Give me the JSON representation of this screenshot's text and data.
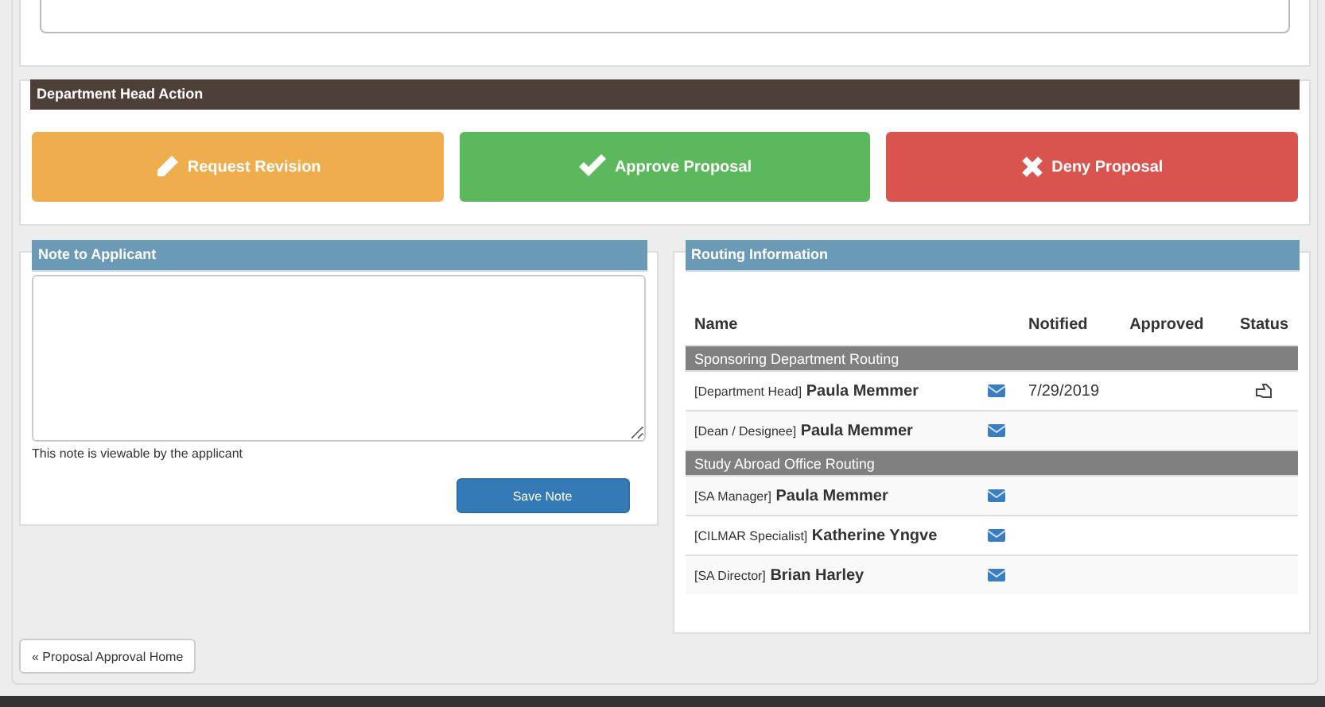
{
  "action_panel": {
    "title": "Department Head Action",
    "buttons": [
      {
        "kind": "revise",
        "label": "Request Revision"
      },
      {
        "kind": "approve",
        "label": "Approve Proposal"
      },
      {
        "kind": "deny",
        "label": "Deny Proposal"
      }
    ]
  },
  "note_panel": {
    "title": "Note to Applicant",
    "help": "This note is viewable by the applicant",
    "save_button": "Save Note"
  },
  "routing": {
    "title": "Routing Information",
    "columns": [
      "Name",
      "Notified",
      "Approved",
      "Status"
    ],
    "rows": [
      {
        "kind": "group",
        "label": "Sponsoring Department Routing"
      },
      {
        "kind": "person",
        "role": "[Department Head]",
        "name": "Paula Memmer",
        "notified": "7/29/2019",
        "awaiting": true
      },
      {
        "kind": "person",
        "role": "[Dean / Designee]",
        "name": "Paula Memmer"
      },
      {
        "kind": "group",
        "label": "Study Abroad Office Routing"
      },
      {
        "kind": "person",
        "role": "[SA Manager]",
        "name": "Paula Memmer"
      },
      {
        "kind": "person",
        "role": "[CILMAR Specialist]",
        "name": "Katherine Yngve"
      },
      {
        "kind": "person",
        "role": "[SA Director]",
        "name": "Brian Harley"
      }
    ]
  },
  "home_link": "« Proposal Approval Home"
}
